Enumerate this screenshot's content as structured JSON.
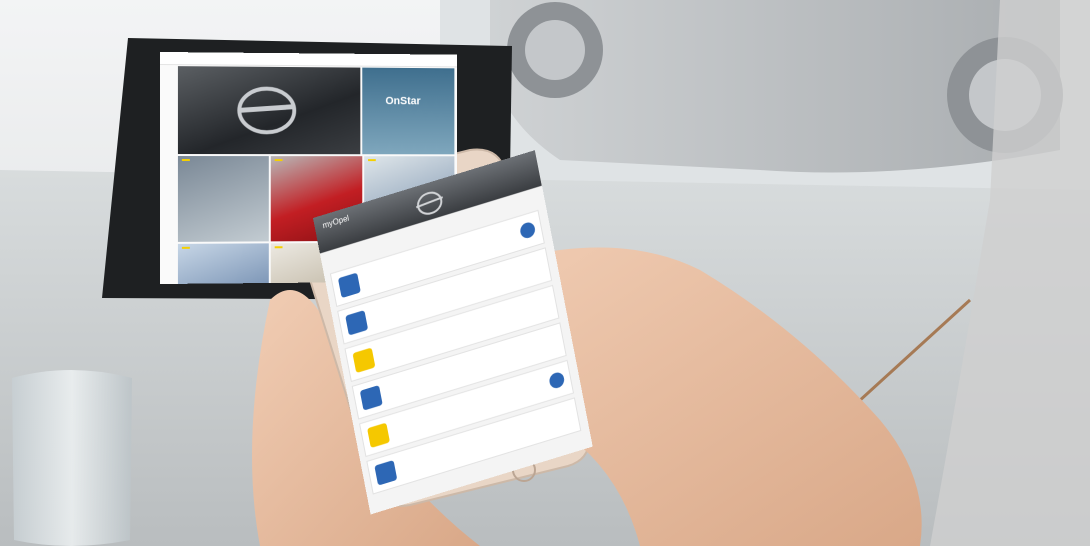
{
  "tablet": {
    "nav_items": [
      "",
      "",
      "",
      ""
    ],
    "hero_caption": "",
    "onstar_logo": "OnStar",
    "tiles": [
      {
        "tag": ""
      },
      {
        "tag": ""
      },
      {
        "tag": ""
      },
      {
        "tag": ""
      },
      {
        "tag": ""
      }
    ]
  },
  "phone": {
    "brand": "myOpel",
    "title": "",
    "items": [
      {
        "label": "",
        "value": "",
        "icon": "key-icon",
        "icon_color": "blue",
        "badge": true
      },
      {
        "label": "",
        "value": "",
        "icon": "car-icon",
        "icon_color": "blue",
        "badge": false
      },
      {
        "label": "",
        "value": "",
        "icon": "yellow-square-icon",
        "icon_color": "yellow",
        "badge": false
      },
      {
        "label": "",
        "value": "",
        "icon": "wrench-icon",
        "icon_color": "blue",
        "badge": false
      },
      {
        "label": "",
        "value": "",
        "icon": "yellow-square-icon",
        "icon_color": "yellow",
        "badge": true
      },
      {
        "label": "",
        "value": "",
        "icon": "globe-icon",
        "icon_color": "blue",
        "badge": false
      }
    ]
  },
  "colors": {
    "opel_yellow": "#f5d000",
    "app_blue": "#2d67b5",
    "phone_gold": "#e9d6c6"
  }
}
